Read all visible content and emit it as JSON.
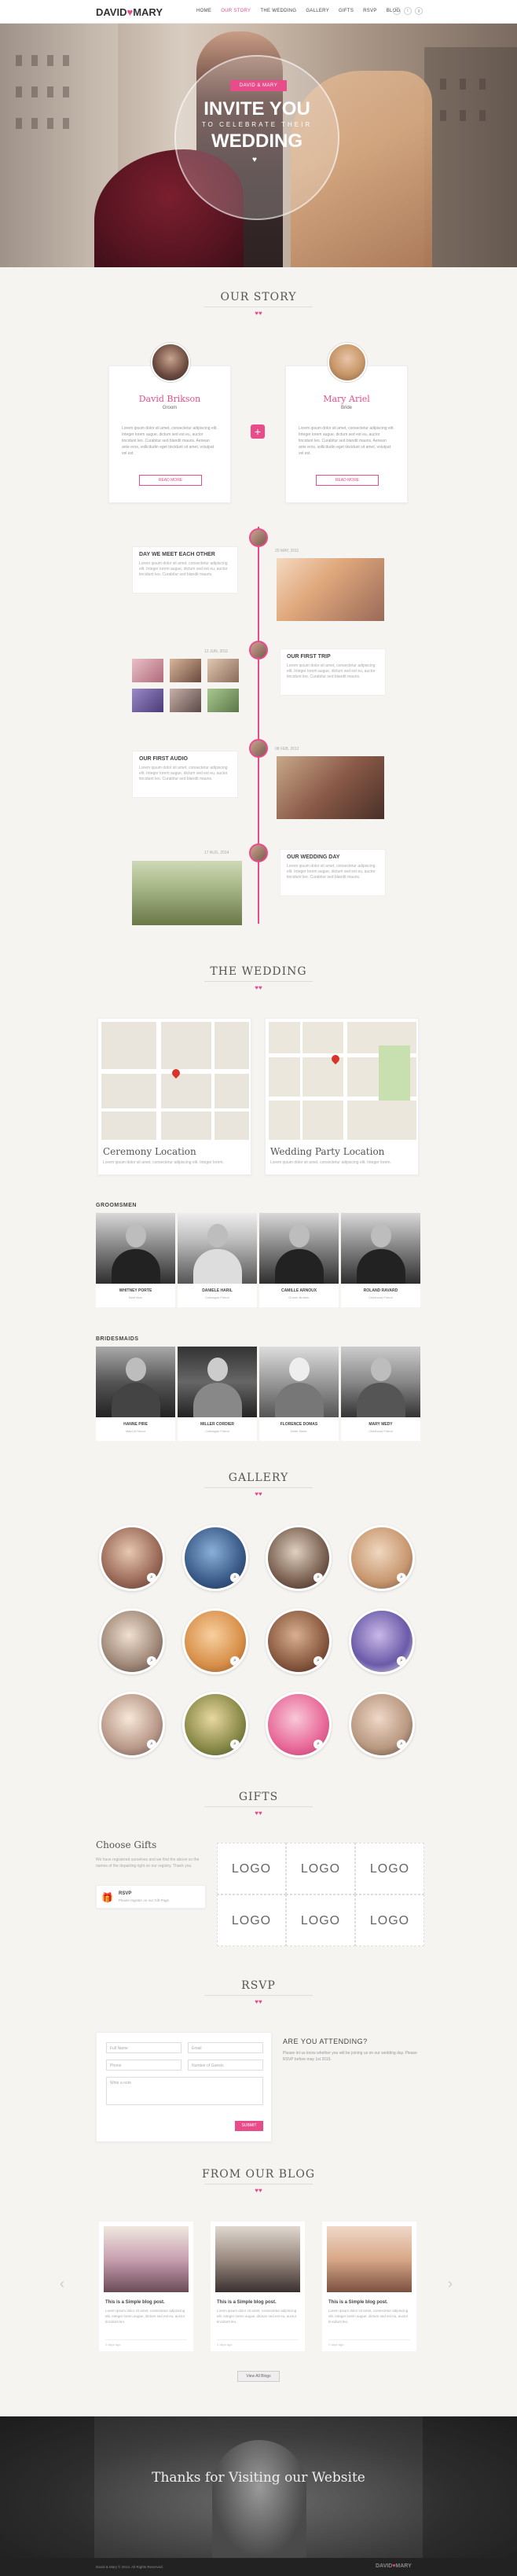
{
  "nav": {
    "logo_left": "DAVID",
    "logo_right": "MARY",
    "items": [
      "HOME",
      "OUR STORY",
      "THE WEDDING",
      "GALLERY",
      "GIFTS",
      "RSVP",
      "BLOG"
    ],
    "active_index": 1,
    "social": [
      "f",
      "t",
      "g"
    ]
  },
  "hero": {
    "badge": "DAVID & MARY",
    "line1": "INVITE YOU",
    "line2": "TO CELEBRATE THEIR",
    "line3": "WEDDING"
  },
  "story": {
    "title": "OUR STORY",
    "groom": {
      "name": "David Brikson",
      "role": "Groom",
      "text": "Lorem ipsum dolor sit amet, consectetur adipiscing elit. Integer lorem augue, dictum sed est eu, auctor tincidunt leo. Curabitur sed blandit mauris. Aenean ante eros, sollicitudin eget tincidunt sit amet, volutpat vel est.",
      "button": "READ MORE"
    },
    "bride": {
      "name": "Mary Ariel",
      "role": "Bride",
      "text": "Lorem ipsum dolor sit amet, consectetur adipiscing elit. Integer lorem augue, dictum sed est eu, auctor tincidunt leo. Curabitur sed blandit mauris. Aenean ante eros, sollicitudin eget tincidunt sit amet, volutpat vel est.",
      "button": "READ MORE"
    },
    "timeline": [
      {
        "title": "DAY WE MEET EACH OTHER",
        "date": "20 MAY, 2011",
        "text": "Lorem ipsum dolor sit amet, consectetur adipiscing elit. Integer lorem augue, dictum sed est eu, auctor tincidunt leo. Curabitur sed blandit mauris."
      },
      {
        "title": "OUR FIRST TRIP",
        "date": "12 JUN, 2011",
        "text": "Lorem ipsum dolor sit amet, consectetur adipiscing elit. Integer lorem augue, dictum sed est eu, auctor tincidunt leo. Curabitur sed blandit mauris."
      },
      {
        "title": "OUR FIRST AUDIO",
        "date": "08 FEB, 2012",
        "text": "Lorem ipsum dolor sit amet, consectetur adipiscing elit. Integer lorem augue, dictum sed est eu, auctor tincidunt leo. Curabitur sed blandit mauris."
      },
      {
        "title": "OUR WEDDING DAY",
        "date": "17 AUG, 2014",
        "text": "Lorem ipsum dolor sit amet, consectetur adipiscing elit. Integer lorem augue, dictum sed est eu, auctor tincidunt leo. Curabitur sed blandit mauris."
      }
    ]
  },
  "wedding": {
    "title": "THE WEDDING",
    "ceremony": {
      "title": "Ceremony Location",
      "text": "Lorem ipsum dolor sit amet, consectetur adipiscing elit. Integer lorem."
    },
    "party": {
      "title": "Wedding Party Location",
      "text": "Lorem ipsum dolor sit amet, consectetur adipiscing elit. Integer lorem."
    },
    "groomsmen_label": "GROOMSMEN",
    "groomsmen": [
      {
        "name": "WHITNEY PORTE",
        "role": "Best Man"
      },
      {
        "name": "DANIELE HARIL",
        "role": "Colleague Friend"
      },
      {
        "name": "CAMILLE ARNOUX",
        "role": "Groom Brother"
      },
      {
        "name": "ROLAND RAVARD",
        "role": "Childhood Friend"
      }
    ],
    "bridesmaids_label": "BRIDESMAIDS",
    "bridesmaids": [
      {
        "name": "HANNE PIRE",
        "role": "Maid of Honor"
      },
      {
        "name": "MILLER CORDIER",
        "role": "Colleague Friend"
      },
      {
        "name": "FLORENCE DOMAS",
        "role": "Bride Sister"
      },
      {
        "name": "MARY MEDY",
        "role": "Childhood Friend"
      }
    ]
  },
  "gallery": {
    "title": "GALLERY"
  },
  "gifts": {
    "title": "GIFTS",
    "heading": "Choose Gifts",
    "text": "We have registered ourselves and we find the above so the names of the departing right on our registry. Thank you.",
    "rsvp_label": "RSVP",
    "rsvp_text": "Please register on our Gift Page",
    "logos": [
      "LOGO",
      "LOGO",
      "LOGO",
      "LOGO",
      "LOGO",
      "LOGO"
    ]
  },
  "rsvp": {
    "title": "RSVP",
    "name_placeholder": "Full Name",
    "email_placeholder": "Email",
    "phone_placeholder": "Phone",
    "guests_placeholder": "Number of Guests",
    "message_placeholder": "Write a note",
    "submit": "SUBMIT",
    "heading": "ARE YOU ATTENDING?",
    "text": "Please let us know whether you will be joining us on our wedding day. Please RSVP before may 1st 2015."
  },
  "blog": {
    "title": "FROM OUR BLOG",
    "posts": [
      {
        "title": "This is a Simple blog post.",
        "text": "Lorem ipsum dolor sit amet, consectetur adipiscing elit. Integer lorem augue, dictum sed est eu, auctor tincidunt leo.",
        "meta": "2 days ago"
      },
      {
        "title": "This is a Simple blog post.",
        "text": "Lorem ipsum dolor sit amet, consectetur adipiscing elit. Integer lorem augue, dictum sed est eu, auctor tincidunt leo.",
        "meta": "2 days ago"
      },
      {
        "title": "This is a Simple blog post.",
        "text": "Lorem ipsum dolor sit amet, consectetur adipiscing elit. Integer lorem augue, dictum sed est eu, auctor tincidunt leo.",
        "meta": "2 days ago"
      }
    ],
    "view_all": "View All Blogs"
  },
  "footer": {
    "thanks": "Thanks for Visiting our Website",
    "copyright": "David & Mary © 2014. All Rights Reserved.",
    "logo_left": "DAVID",
    "logo_right": "MARY"
  },
  "colors": {
    "accent": "#e84c8b",
    "background": "#f5f4f1"
  }
}
